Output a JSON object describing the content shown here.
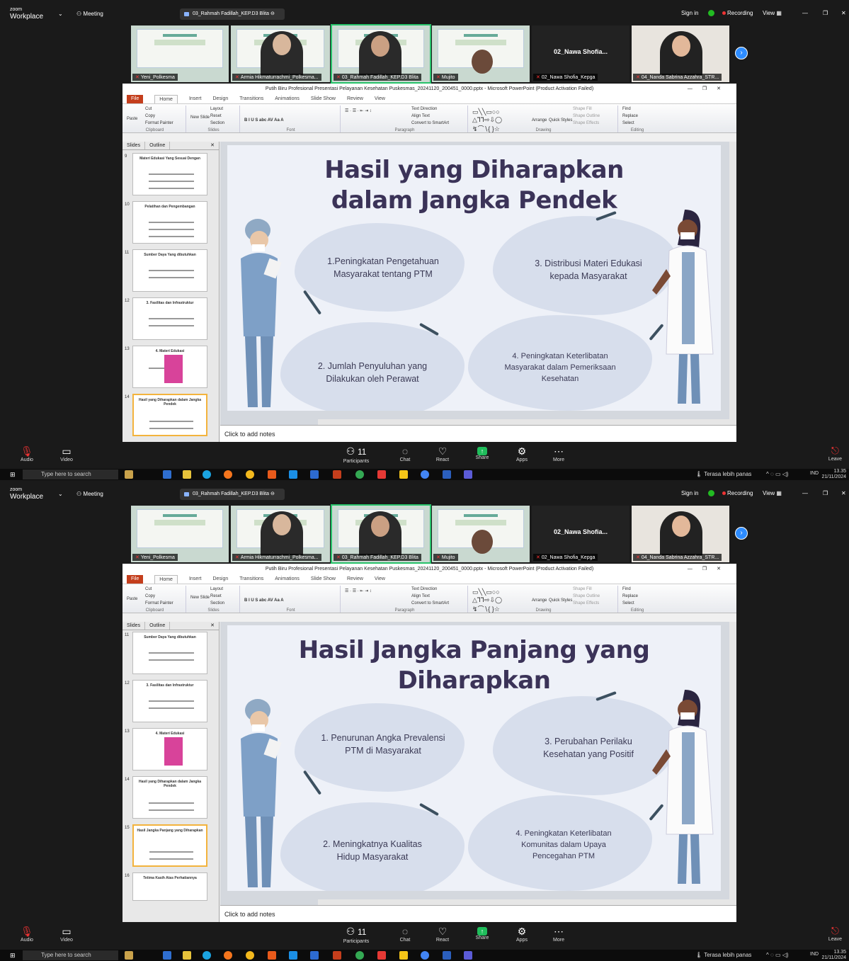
{
  "zoom": {
    "logo_small": "zoom",
    "logo_big": "Workplace",
    "meeting_label": "Meeting",
    "sharing_pill": "03_Rahmah Fadillah_KEP.D3 Blita",
    "sign_in": "Sign in",
    "recording": "Recording",
    "view": "View",
    "participants_tiles": [
      {
        "name": "Yeni_Polkesma"
      },
      {
        "name": "Armia Hikmaturrachmi_Polkesma..."
      },
      {
        "name": "03_Rahmah Fadillah_KEP.D3 Blita"
      },
      {
        "name": "Mujito"
      },
      {
        "name": "02_Nawa Shofia_Kepga",
        "big_name": "02_Nawa Shofia..."
      },
      {
        "name": "04_Nanda Sabrina Azzahra_STR..."
      }
    ],
    "controls": {
      "audio": "Audio",
      "video": "Video",
      "participants": "Participants",
      "participants_count": "11",
      "chat": "Chat",
      "react": "React",
      "share": "Share",
      "apps": "Apps",
      "more": "More",
      "leave": "Leave"
    }
  },
  "powerpoint": {
    "window_title": "Putih Biru Profesional Presentasi Pelayanan Kesehatan Puskesmas_20241120_200451_0000.pptx - Microsoft PowerPoint (Product Activation Failed)",
    "tabs": [
      "File",
      "Home",
      "Insert",
      "Design",
      "Transitions",
      "Animations",
      "Slide Show",
      "Review",
      "View"
    ],
    "ribbon": {
      "paste": "Paste",
      "cut": "Cut",
      "copy": "Copy",
      "format_painter": "Format Painter",
      "clipboard": "Clipboard",
      "new_slide": "New Slide",
      "layout": "Layout",
      "reset": "Reset",
      "section": "Section",
      "slides_group": "Slides",
      "font_group": "Font",
      "paragraph_group": "Paragraph",
      "text_direction": "Text Direction",
      "align_text": "Align Text",
      "convert_smartart": "Convert to SmartArt",
      "arrange": "Arrange",
      "quick_styles": "Quick Styles",
      "shape_fill": "Shape Fill",
      "shape_outline": "Shape Outline",
      "shape_effects": "Shape Effects",
      "drawing_group": "Drawing",
      "find": "Find",
      "replace": "Replace",
      "select": "Select",
      "editing_group": "Editing"
    },
    "pane_tabs": [
      "Slides",
      "Outline"
    ],
    "notes_placeholder": "Click to add notes"
  },
  "screen1": {
    "thumbnails": [
      {
        "num": "9",
        "title": "Materi Edukasi Yang Sesuai Dengan"
      },
      {
        "num": "10",
        "title": "Pelatihan dan Pengembangan"
      },
      {
        "num": "11",
        "title": "Sumber Daya Yang dibutuhkan"
      },
      {
        "num": "12",
        "title": "3. Fasilitas dan Infrastruktur"
      },
      {
        "num": "13",
        "title": "4. Materi Edukasi"
      },
      {
        "num": "14",
        "title": "Hasil yang Diharapkan dalam Jangka Pendek"
      }
    ],
    "slide": {
      "title_line1": "Hasil yang Diharapkan",
      "title_line2": "dalam Jangka Pendek",
      "point1_l1": "1.Peningkatan Pengetahuan",
      "point1_l2": "Masyarakat tentang PTM",
      "point2_l1": "2. Jumlah Penyuluhan yang",
      "point2_l2": "Dilakukan oleh Perawat",
      "point3_l1": "3. Distribusi Materi Edukasi",
      "point3_l2": "kepada Masyarakat",
      "point4_l1": "4. Peningkatan Keterlibatan",
      "point4_l2": "Masyarakat dalam Pemeriksaan",
      "point4_l3": "Kesehatan"
    }
  },
  "screen2": {
    "thumbnails": [
      {
        "num": "11",
        "title": "Sumber Daya Yang dibutuhkan"
      },
      {
        "num": "12",
        "title": "3. Fasilitas dan Infrastruktur"
      },
      {
        "num": "13",
        "title": "4. Materi Edukasi"
      },
      {
        "num": "14",
        "title": "Hasil yang Diharapkan dalam Jangka Pendek"
      },
      {
        "num": "15",
        "title": "Hasil Jangka Panjang yang Diharapkan"
      },
      {
        "num": "16",
        "title": "Tetima Kasih Atas Perhatiannya"
      }
    ],
    "slide": {
      "title_line1": "Hasil Jangka Panjang yang",
      "title_line2": "Diharapkan",
      "point1_l1": "1. Penurunan Angka Prevalensi",
      "point1_l2": "PTM di Masyarakat",
      "point2_l1": "2. Meningkatnya Kualitas",
      "point2_l2": "Hidup Masyarakat",
      "point3_l1": "3. Perubahan Perilaku",
      "point3_l2": "Kesehatan yang Positif",
      "point4_l1": "4. Peningkatan Keterlibatan",
      "point4_l2": "Komunitas dalam Upaya",
      "point4_l3": "Pencegahan PTM"
    }
  },
  "taskbar": {
    "search_placeholder": "Type here to search",
    "weather": "Terasa lebih panas",
    "lang": "IND",
    "time": "13.35",
    "date": "21/11/2024"
  }
}
